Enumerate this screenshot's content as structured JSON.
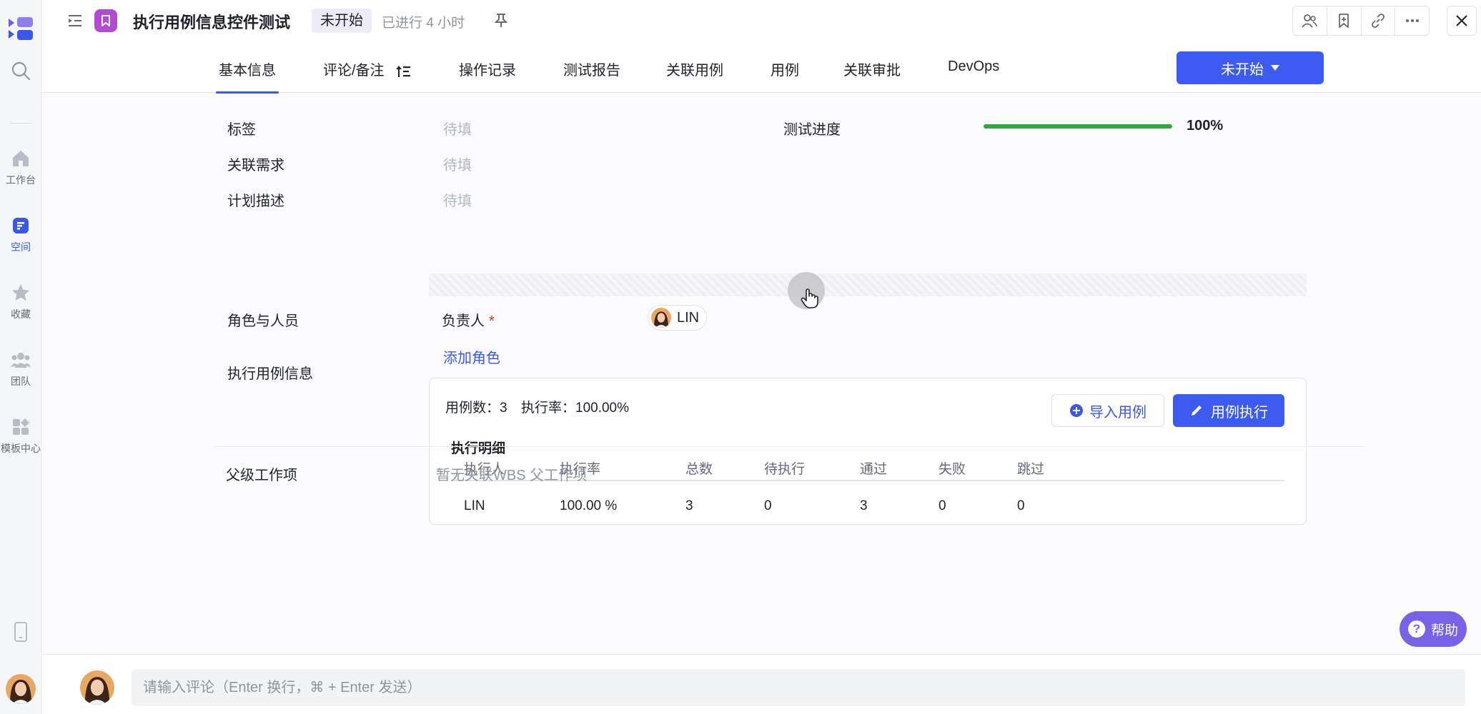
{
  "rail": {
    "items": [
      {
        "label": "工作台"
      },
      {
        "label": "空间"
      },
      {
        "label": "收藏"
      },
      {
        "label": "团队"
      },
      {
        "label": "模板中心"
      }
    ]
  },
  "header": {
    "title": "执行用例信息控件测试",
    "status": "未开始",
    "elapsed": "已进行 4 小时"
  },
  "tabs": [
    {
      "label": "基本信息"
    },
    {
      "label": "评论/备注"
    },
    {
      "label": "操作记录"
    },
    {
      "label": "测试报告"
    },
    {
      "label": "关联用例"
    },
    {
      "label": "用例"
    },
    {
      "label": "关联审批"
    },
    {
      "label": "DevOps"
    }
  ],
  "status_button": {
    "label": "未开始"
  },
  "fields": {
    "tags": {
      "label": "标签",
      "placeholder": "待填"
    },
    "related_req": {
      "label": "关联需求",
      "placeholder": "待填"
    },
    "plan_desc": {
      "label": "计划描述",
      "placeholder": "待填"
    },
    "progress": {
      "label": "测试进度",
      "value": "100%",
      "fraction": 1.0
    }
  },
  "roles": {
    "label": "角色与人员",
    "owner_label": "负责人",
    "required_mark": "*",
    "owner": "LIN",
    "add_role": "添加角色"
  },
  "exec_info": {
    "label": "执行用例信息",
    "case_count_label": "用例数：",
    "case_count": "3",
    "exec_rate_label": "执行率：",
    "exec_rate": "100.00%",
    "import_button": "导入用例",
    "execute_button": "用例执行",
    "detail_title": "执行明细",
    "columns": [
      "执行人",
      "执行率",
      "总数",
      "待执行",
      "通过",
      "失败",
      "跳过"
    ],
    "rows": [
      [
        "LIN",
        "100.00 %",
        "3",
        "0",
        "3",
        "0",
        "0"
      ]
    ]
  },
  "parent": {
    "label": "父级工作项",
    "value": "暂无关联WBS 父工作项"
  },
  "help": {
    "label": "帮助"
  },
  "comment": {
    "placeholder": "请输入评论（Enter 换行，⌘ + Enter 发送）"
  },
  "colors": {
    "accent": "#3d5bf0",
    "progress": "#2fa73b",
    "type_badge": "#b04bd3",
    "help": "#7a62e8"
  }
}
